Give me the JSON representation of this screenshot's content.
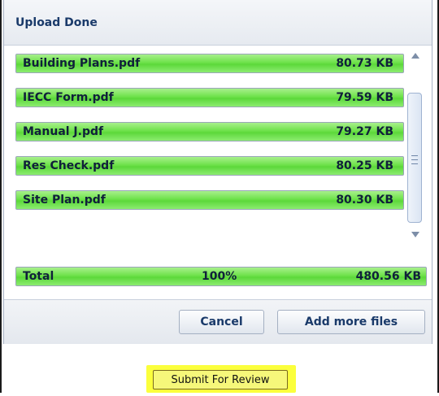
{
  "dialog": {
    "title": "Upload Done",
    "files": [
      {
        "name": "Building Plans.pdf",
        "size": "80.73 KB"
      },
      {
        "name": "IECC Form.pdf",
        "size": "79.59 KB"
      },
      {
        "name": "Manual J.pdf",
        "size": "79.27 KB"
      },
      {
        "name": "Res Check.pdf",
        "size": "80.25 KB"
      },
      {
        "name": "Site Plan.pdf",
        "size": "80.30 KB"
      }
    ],
    "total": {
      "label": "Total",
      "percent": "100%",
      "size": "480.56 KB"
    },
    "buttons": {
      "cancel": "Cancel",
      "add_more": "Add more files"
    }
  },
  "submit": {
    "label": "Submit For Review"
  },
  "colors": {
    "progress_green": "#6ee24a",
    "highlight_yellow": "#fbff3c",
    "title_blue": "#1a3a6a"
  },
  "icons": {
    "scroll_up": "chevron-up-icon",
    "scroll_down": "chevron-down-icon",
    "scroll_grip": "grip-icon"
  }
}
